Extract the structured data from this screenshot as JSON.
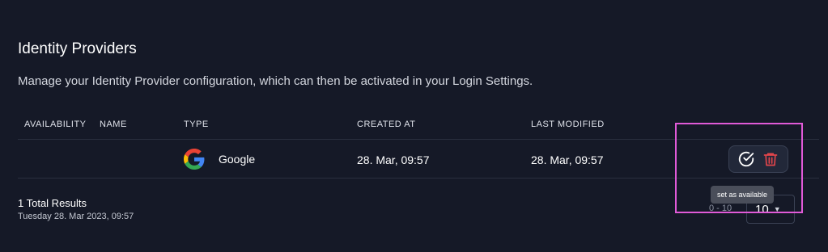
{
  "header": {
    "title": "Identity Providers",
    "description": "Manage your Identity Provider configuration, which can then be activated in your Login Settings."
  },
  "table": {
    "columns": {
      "availability": "AVAILABILITY",
      "name": "NAME",
      "type": "TYPE",
      "created_at": "CREATED AT",
      "last_modified": "LAST MODIFIED"
    },
    "rows": [
      {
        "availability": "",
        "name": "",
        "type": "Google",
        "type_icon": "google-g-icon",
        "created_at": "28. Mar, 09:57",
        "last_modified": "28. Mar, 09:57",
        "actions": [
          {
            "icon": "check-circle-icon",
            "tooltip": "set as available"
          },
          {
            "icon": "trash-icon"
          }
        ]
      }
    ]
  },
  "tooltip": {
    "text": "set as available"
  },
  "footer": {
    "total_results": "1 Total Results",
    "timestamp": "Tuesday 28. Mar 2023, 09:57",
    "page_range": "0 - 10",
    "page_size": "10"
  },
  "colors": {
    "background": "#151927",
    "delete_icon": "#e0454b",
    "highlight_box": "#e05ad8"
  }
}
